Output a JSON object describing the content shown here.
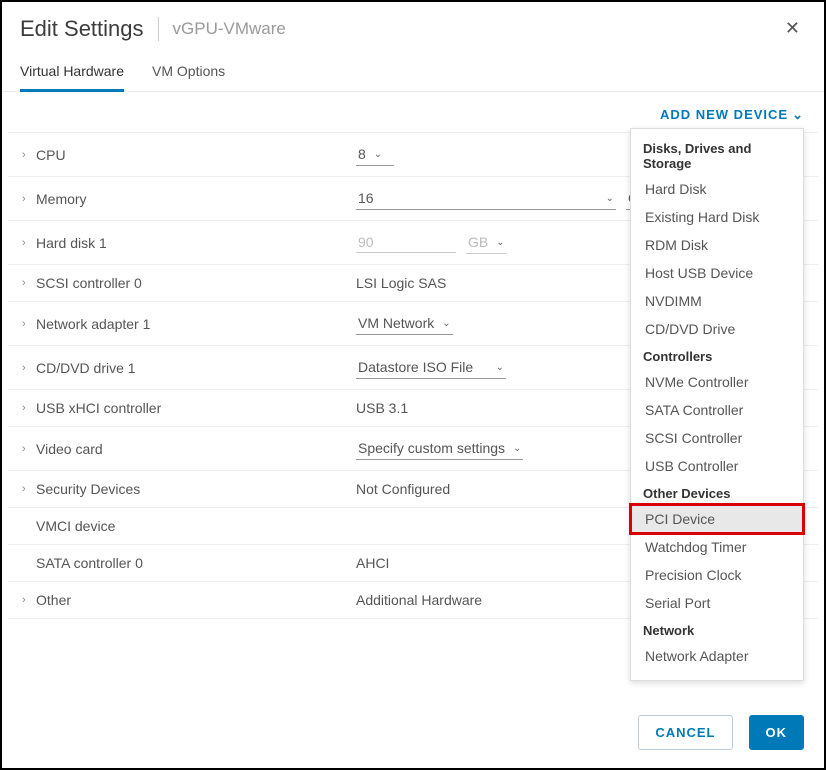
{
  "header": {
    "title": "Edit Settings",
    "subtitle": "vGPU-VMware"
  },
  "tabs": [
    "Virtual Hardware",
    "VM Options"
  ],
  "addDevice": {
    "label": "ADD NEW DEVICE",
    "sections": [
      {
        "title": "Disks, Drives and Storage",
        "items": [
          "Hard Disk",
          "Existing Hard Disk",
          "RDM Disk",
          "Host USB Device",
          "NVDIMM",
          "CD/DVD Drive"
        ]
      },
      {
        "title": "Controllers",
        "items": [
          "NVMe Controller",
          "SATA Controller",
          "SCSI Controller",
          "USB Controller"
        ]
      },
      {
        "title": "Other Devices",
        "items": [
          "PCI Device",
          "Watchdog Timer",
          "Precision Clock",
          "Serial Port"
        ]
      },
      {
        "title": "Network",
        "items": [
          "Network Adapter"
        ]
      }
    ]
  },
  "rows": {
    "cpu": {
      "label": "CPU",
      "value": "8"
    },
    "memory": {
      "label": "Memory",
      "value": "16",
      "unit": "GB"
    },
    "hardDisk": {
      "label": "Hard disk 1",
      "value": "90",
      "unit": "GB"
    },
    "scsi": {
      "label": "SCSI controller 0",
      "value": "LSI Logic SAS"
    },
    "network": {
      "label": "Network adapter 1",
      "value": "VM Network"
    },
    "cddvd": {
      "label": "CD/DVD drive 1",
      "value": "Datastore ISO File"
    },
    "usb": {
      "label": "USB xHCI controller",
      "value": "USB 3.1"
    },
    "video": {
      "label": "Video card",
      "value": "Specify custom settings"
    },
    "security": {
      "label": "Security Devices",
      "value": "Not Configured"
    },
    "vmci": {
      "label": "VMCI device"
    },
    "sata": {
      "label": "SATA controller 0",
      "value": "AHCI"
    },
    "other": {
      "label": "Other",
      "value": "Additional Hardware"
    }
  },
  "footer": {
    "cancel": "CANCEL",
    "ok": "OK"
  }
}
